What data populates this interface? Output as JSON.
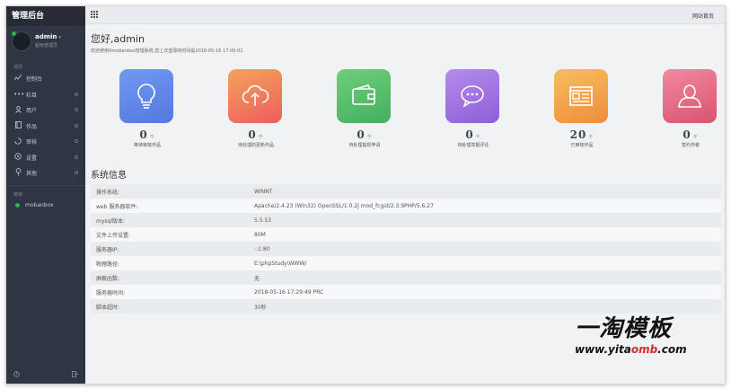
{
  "sidebar": {
    "title": "管理后台",
    "user": {
      "name": "admin",
      "role": "超级管理员"
    },
    "nav_section": "选项",
    "nav": [
      {
        "label": "控制台",
        "icon": "chart-line-icon"
      },
      {
        "label": "栏目",
        "icon": "dots-icon"
      },
      {
        "label": "用户",
        "icon": "user-icon"
      },
      {
        "label": "作品",
        "icon": "book-icon"
      },
      {
        "label": "审核",
        "icon": "spinner-icon"
      },
      {
        "label": "设置",
        "icon": "settings-icon"
      },
      {
        "label": "其他",
        "icon": "location-icon"
      }
    ],
    "link_section": "链接",
    "links": [
      {
        "label": "mobanbox"
      }
    ]
  },
  "topbar": {
    "home_link": "网站首页"
  },
  "greeting": "您好,admin",
  "welcome": "欢迎使用Xmobanbox管理系统,您上次登录的时间是2018-05-16 17:00:01",
  "cards": [
    {
      "value": "0",
      "unit": "个",
      "label": "等待审核作品",
      "color": "#5b87e8",
      "icon": "bulb-icon"
    },
    {
      "value": "0",
      "unit": "个",
      "label": "待处理的更新作品",
      "color": "#f06b5e",
      "icon": "cloud-upload-icon"
    },
    {
      "value": "0",
      "unit": "个",
      "label": "待处理提现申请",
      "color": "#4fbd67",
      "icon": "wallet-icon"
    },
    {
      "value": "0",
      "unit": "个",
      "label": "待处理举报评论",
      "color": "#9d6ee0",
      "icon": "chat-icon"
    },
    {
      "value": "20",
      "unit": "个",
      "label": "已审核作品",
      "color": "#f2a24a",
      "icon": "browser-icon"
    },
    {
      "value": "0",
      "unit": "个",
      "label": "签约作者",
      "color": "#e0607a",
      "icon": "person-icon"
    }
  ],
  "system": {
    "title": "系统信息",
    "rows": [
      {
        "key": "操作系统:",
        "value": "WINNT"
      },
      {
        "key": "web 服务器软件:",
        "value": "Apache/2.4.23 (Win32) OpenSSL/1.0.2j mod_fcgid/2.3.9PHP/5.6.27"
      },
      {
        "key": "mysql版本:",
        "value": "5.5.53"
      },
      {
        "key": "文件上传设置:",
        "value": "80M"
      },
      {
        "key": "服务器IP:",
        "value": "::1:80"
      },
      {
        "key": "物理路径:",
        "value": "E:\\phpStudy\\WWW/"
      },
      {
        "key": "屏蔽函数:",
        "value": "无"
      },
      {
        "key": "服务器时间:",
        "value": "2018-05-16 17:29:49 PRC"
      },
      {
        "key": "脚本超时:",
        "value": "30秒"
      }
    ]
  },
  "watermark": {
    "cn": "一淘模板",
    "url_a": "www.yita",
    "url_b": "omb",
    "url_c": ".com"
  }
}
